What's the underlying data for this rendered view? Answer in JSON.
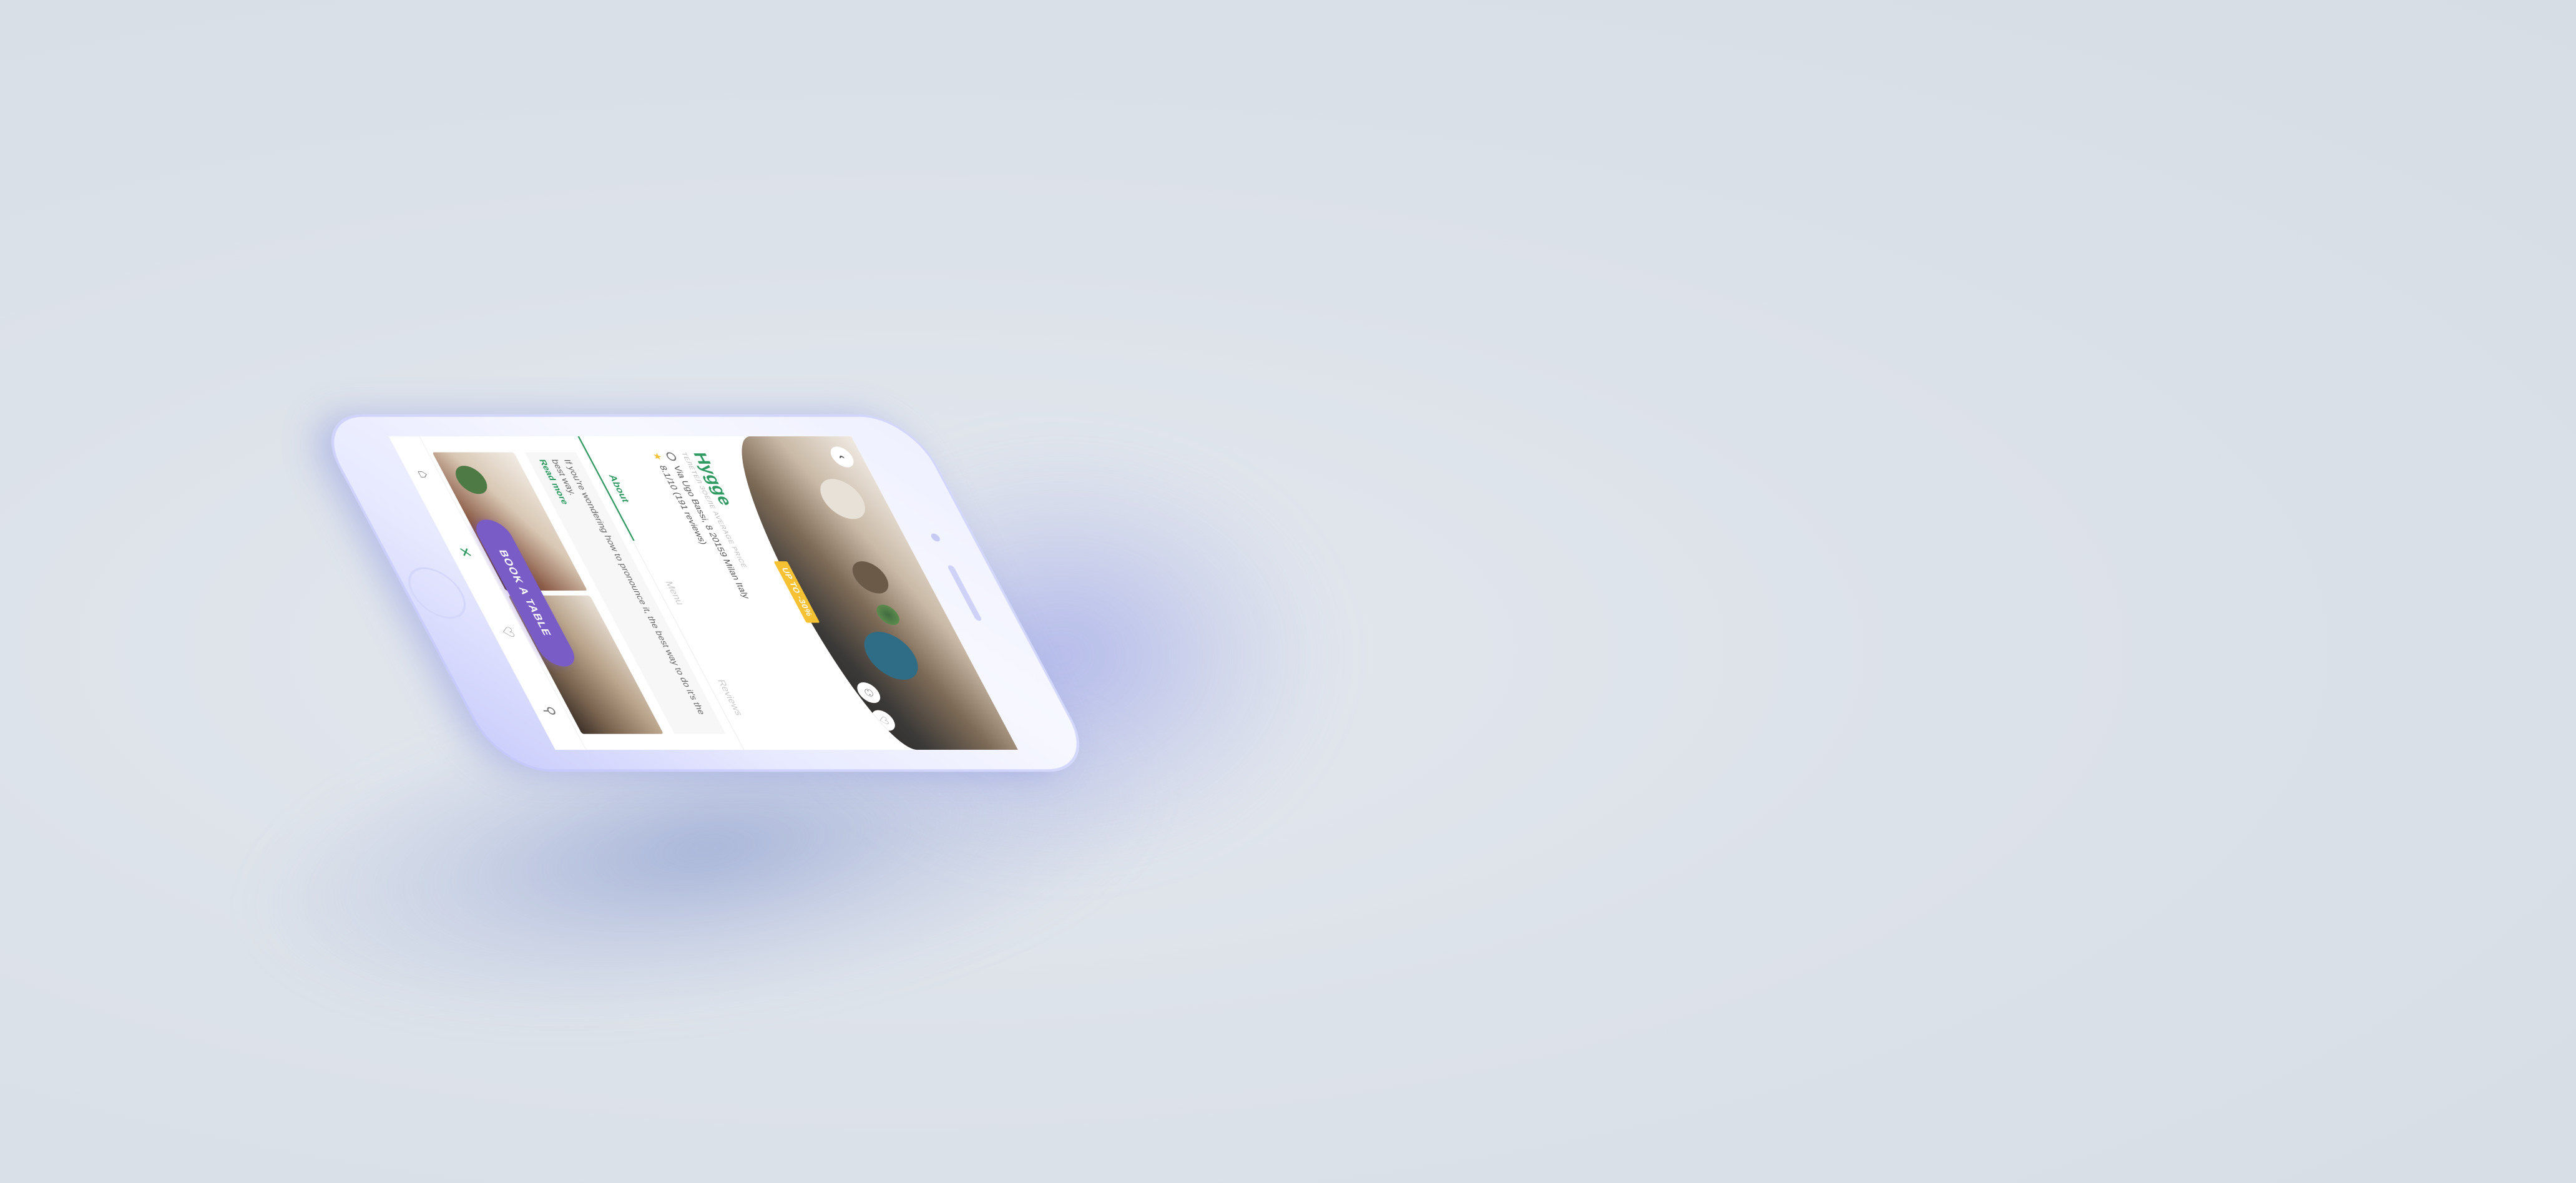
{
  "restaurant": {
    "name": "Hygge",
    "subtitle": "ТЕЛЕТЕЛ ЗОЕЛЕ AVERAGE PRICE",
    "address": "Via Ugo Bassi, 8 20159 Milan Italy",
    "rating": "8.1/10 (191 reviews)",
    "promo": "UP TO -30%"
  },
  "tabs": [
    {
      "label": "About"
    },
    {
      "label": "Menu"
    },
    {
      "label": "Reviews"
    }
  ],
  "about": {
    "text": "If you're wondering how to pronounce it, the best way to do it's the best way.",
    "read_more": "Read more"
  },
  "cta": {
    "book_label": "BOOK A TABLE"
  },
  "icons": {
    "back": "back-chevron-icon",
    "share": "share-icon",
    "favorite": "heart-icon",
    "location": "pin-icon",
    "rating": "star-icon",
    "nav_home": "home-icon",
    "nav_restaurant": "cutlery-icon",
    "nav_favorites": "heart-icon",
    "nav_profile": "user-icon"
  },
  "colors": {
    "accent_green": "#2f9a62",
    "button_purple": "#7a5cc7",
    "promo_yellow": "#f6c233",
    "background": "#dce2e9",
    "phone_body": "#eef0ff"
  },
  "glyphs": {
    "back": "‹",
    "share": "⚇",
    "favorite": "♡",
    "star": "★",
    "home": "⌂",
    "cutlery": "✕",
    "heart": "♡",
    "user": "⚲"
  }
}
